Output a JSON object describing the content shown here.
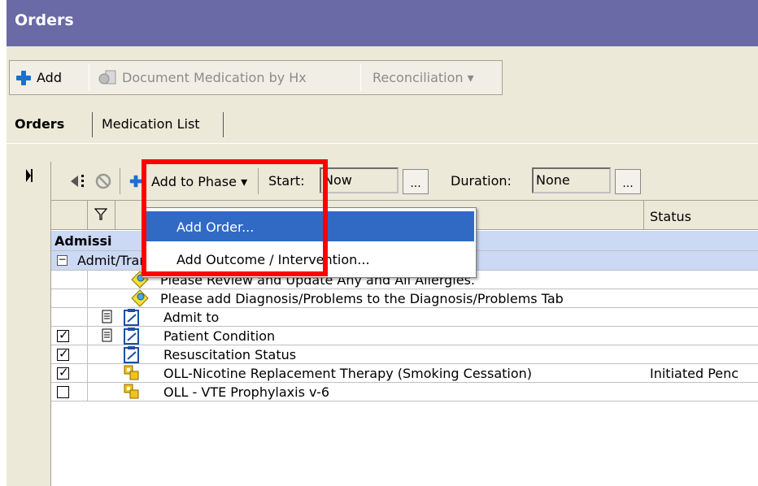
{
  "window": {
    "title": "Orders"
  },
  "toolbar": {
    "add_label": "Add",
    "document_med_label": "Document Medication by Hx",
    "reconciliation_label": "Reconciliation ▾"
  },
  "tabs": [
    {
      "label": "Orders"
    },
    {
      "label": "Medication List"
    }
  ],
  "grid_toolbar": {
    "add_to_phase_label": "Add to Phase ▾",
    "start_label": "Start:",
    "start_value": "Now",
    "ellipsis": "...",
    "duration_label": "Duration:",
    "duration_value": "None"
  },
  "columns": {
    "status": "Status"
  },
  "menu": {
    "items": [
      {
        "label": "Add Order..."
      },
      {
        "label": "Add Outcome / Intervention..."
      }
    ]
  },
  "sections": {
    "admission": "Admissi",
    "admit_transfer": "Admit/Transfer/Discharge"
  },
  "rows": [
    {
      "text": "Please Review and Update Any and All Allergies.",
      "checkbox": "none"
    },
    {
      "text": "Please add Diagnosis/Problems to the Diagnosis/Problems Tab",
      "checkbox": "none"
    },
    {
      "text": "Admit to",
      "checkbox": "none"
    },
    {
      "text": "Patient Condition",
      "checkbox": "checked"
    },
    {
      "text": "Resuscitation Status",
      "checkbox": "checked"
    },
    {
      "text": "OLL-Nicotine Replacement Therapy (Smoking Cessation)",
      "checkbox": "checked",
      "status": "Initiated Penc"
    },
    {
      "text": "OLL - VTE Prophylaxis v-6",
      "checkbox": "unchecked"
    }
  ],
  "colors": {
    "titlebar": "#6a6aa6",
    "highlight": "#316ac5",
    "section": "#ccd9f4",
    "callout": "#ff0000"
  }
}
